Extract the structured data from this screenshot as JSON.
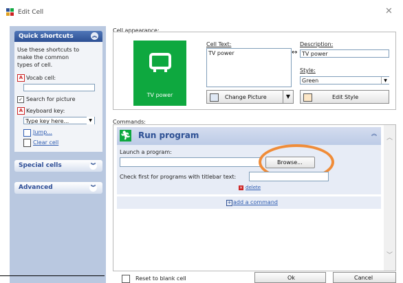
{
  "window": {
    "title": "Edit Cell",
    "close_glyph": "✕"
  },
  "shortcuts": {
    "heading": "Quick shortcuts",
    "description": [
      "Use these shortcuts to",
      "make the common",
      "types of cell."
    ],
    "vocab_label": "Vocab cell:",
    "vocab_value": "",
    "search_picture_label": "Search for picture",
    "search_picture_checked": true,
    "keyboard_label": "Keyboard key:",
    "keyboard_value": "Type key here...",
    "jump_link": "Jump...",
    "clear_link": "Clear cell"
  },
  "special_cells": {
    "label": "Special cells"
  },
  "advanced": {
    "label": "Advanced"
  },
  "appearance": {
    "label": "Cell appearance:",
    "preview_text": "TV power",
    "preview_color": "#0ea83f",
    "cell_text_label": "Cell Text:",
    "cell_text_value": "TV power",
    "description_label": "Description:",
    "description_value": "TV power",
    "style_label": "Style:",
    "style_value": "Green",
    "change_picture_label": "Change Picture",
    "edit_style_label": "Edit Style"
  },
  "commands": {
    "label": "Commands:",
    "run_title": "Run program",
    "launch_label": "Launch a program:",
    "launch_value": "",
    "browse_label": "Browse...",
    "check_label": "Check first for programs with titlebar text:",
    "check_value": "",
    "delete_label": "delete",
    "add_command_label": "add a command"
  },
  "footer": {
    "reset_label": "Reset to blank cell",
    "ok_label": "Ok",
    "cancel_label": "Cancel"
  },
  "icons": {
    "app": "app-icon",
    "tv": "tv-icon",
    "run": "running-man-icon",
    "picture": "picture-icon",
    "edit_style": "paint-icon"
  },
  "colors": {
    "accent_blue": "#2c4f93",
    "highlight_orange": "#f08c38"
  }
}
